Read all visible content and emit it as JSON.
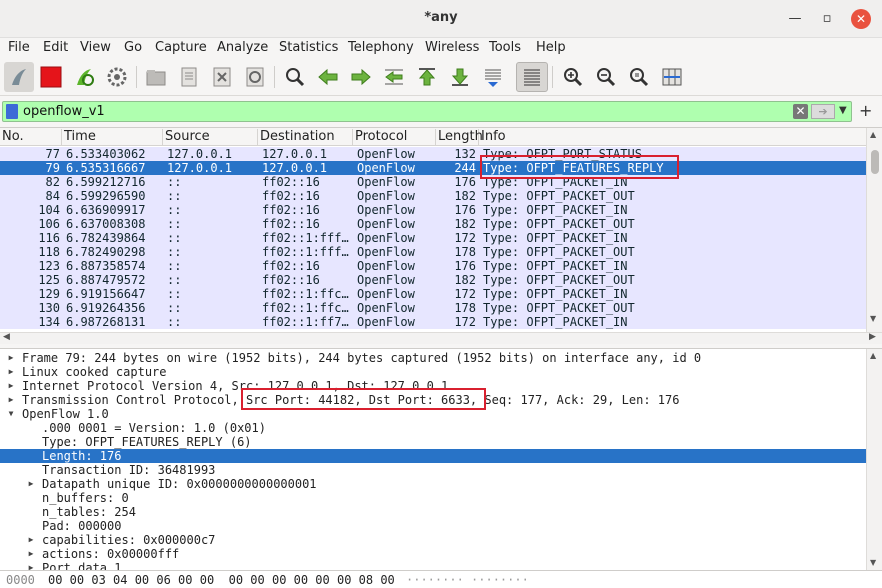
{
  "window": {
    "title": "*any"
  },
  "menu": [
    "File",
    "Edit",
    "View",
    "Go",
    "Capture",
    "Analyze",
    "Statistics",
    "Telephony",
    "Wireless",
    "Tools",
    "Help"
  ],
  "filter": {
    "value": "openflow_v1"
  },
  "columns": [
    "No.",
    "Time",
    "Source",
    "Destination",
    "Protocol",
    "Length",
    "Info"
  ],
  "packets": [
    {
      "no": "77",
      "time": "6.533403062",
      "src": "127.0.0.1",
      "dst": "127.0.0.1",
      "proto": "OpenFlow",
      "len": "132",
      "info": "Type: OFPT_PORT_STATUS"
    },
    {
      "no": "79",
      "time": "6.535316667",
      "src": "127.0.0.1",
      "dst": "127.0.0.1",
      "proto": "OpenFlow",
      "len": "244",
      "info": "Type: OFPT_FEATURES_REPLY",
      "selected": true
    },
    {
      "no": "82",
      "time": "6.599212716",
      "src": "::",
      "dst": "ff02::16",
      "proto": "OpenFlow",
      "len": "176",
      "info": "Type: OFPT_PACKET_IN"
    },
    {
      "no": "84",
      "time": "6.599296590",
      "src": "::",
      "dst": "ff02::16",
      "proto": "OpenFlow",
      "len": "182",
      "info": "Type: OFPT_PACKET_OUT"
    },
    {
      "no": "104",
      "time": "6.636909917",
      "src": "::",
      "dst": "ff02::16",
      "proto": "OpenFlow",
      "len": "176",
      "info": "Type: OFPT_PACKET_IN"
    },
    {
      "no": "106",
      "time": "6.637008308",
      "src": "::",
      "dst": "ff02::16",
      "proto": "OpenFlow",
      "len": "182",
      "info": "Type: OFPT_PACKET_OUT"
    },
    {
      "no": "116",
      "time": "6.782439864",
      "src": "::",
      "dst": "ff02::1:fff…",
      "proto": "OpenFlow",
      "len": "172",
      "info": "Type: OFPT_PACKET_IN"
    },
    {
      "no": "118",
      "time": "6.782490298",
      "src": "::",
      "dst": "ff02::1:fff…",
      "proto": "OpenFlow",
      "len": "178",
      "info": "Type: OFPT_PACKET_OUT"
    },
    {
      "no": "123",
      "time": "6.887358574",
      "src": "::",
      "dst": "ff02::16",
      "proto": "OpenFlow",
      "len": "176",
      "info": "Type: OFPT_PACKET_IN"
    },
    {
      "no": "125",
      "time": "6.887479572",
      "src": "::",
      "dst": "ff02::16",
      "proto": "OpenFlow",
      "len": "182",
      "info": "Type: OFPT_PACKET_OUT"
    },
    {
      "no": "129",
      "time": "6.919156647",
      "src": "::",
      "dst": "ff02::1:ffc…",
      "proto": "OpenFlow",
      "len": "172",
      "info": "Type: OFPT_PACKET_IN"
    },
    {
      "no": "130",
      "time": "6.919264356",
      "src": "::",
      "dst": "ff02::1:ffc…",
      "proto": "OpenFlow",
      "len": "178",
      "info": "Type: OFPT_PACKET_OUT"
    },
    {
      "no": "134",
      "time": "6.987268131",
      "src": "::",
      "dst": "ff02::1:ff7…",
      "proto": "OpenFlow",
      "len": "172",
      "info": "Type: OFPT_PACKET_IN"
    }
  ],
  "details": [
    {
      "text": "Frame 79: 244 bytes on wire (1952 bits), 244 bytes captured (1952 bits) on interface any, id 0",
      "arrow": "right",
      "indent": 0
    },
    {
      "text": "Linux cooked capture",
      "arrow": "right",
      "indent": 0
    },
    {
      "text": "Internet Protocol Version 4, Src: 127.0.0.1, Dst: 127.0.0.1",
      "arrow": "right",
      "indent": 0
    },
    {
      "text": "Transmission Control Protocol, Src Port: 44182, Dst Port: 6633, Seq: 177, Ack: 29, Len: 176",
      "arrow": "right",
      "indent": 0
    },
    {
      "text": "OpenFlow 1.0",
      "arrow": "down",
      "indent": 0
    },
    {
      "text": ".000 0001 = Version: 1.0 (0x01)",
      "arrow": "",
      "indent": 1
    },
    {
      "text": "Type: OFPT_FEATURES_REPLY (6)",
      "arrow": "",
      "indent": 1
    },
    {
      "text": "Length: 176",
      "arrow": "",
      "indent": 1,
      "selected": true
    },
    {
      "text": "Transaction ID: 36481993",
      "arrow": "",
      "indent": 1
    },
    {
      "text": "Datapath unique ID: 0x0000000000000001",
      "arrow": "right",
      "indent": 1
    },
    {
      "text": "n_buffers: 0",
      "arrow": "",
      "indent": 1
    },
    {
      "text": "n_tables: 254",
      "arrow": "",
      "indent": 1
    },
    {
      "text": "Pad: 000000",
      "arrow": "",
      "indent": 1
    },
    {
      "text": "capabilities: 0x000000c7",
      "arrow": "right",
      "indent": 1
    },
    {
      "text": "actions: 0x00000fff",
      "arrow": "right",
      "indent": 1
    },
    {
      "text": "Port data 1",
      "arrow": "right",
      "indent": 1
    }
  ],
  "bytes": {
    "offset": "0000",
    "hex": "00 00 03 04 00 06 00 00  00 00 00 00 00 00 08 00",
    "ascii": "········ ········"
  },
  "colors": {
    "selected": "#2873c7",
    "row_bg": "#e7e6ff",
    "filter_bg": "#afffaf",
    "highlight_box": "#d9202f"
  }
}
